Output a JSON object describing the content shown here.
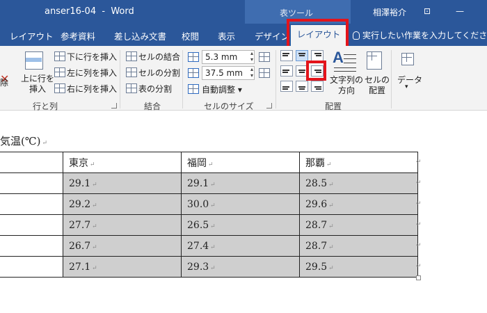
{
  "titlebar": {
    "title": "anser16-04  -  Word",
    "context_tools": "表ツール",
    "user": "相澤裕介",
    "restore_icon": "ribbon-display-icon",
    "minimize_icon": "minimize-icon"
  },
  "tabs": [
    {
      "label": "レイアウト"
    },
    {
      "label": "参考資料"
    },
    {
      "label": "差し込み文書"
    },
    {
      "label": "校閲"
    },
    {
      "label": "表示"
    },
    {
      "label": "デザイン"
    },
    {
      "label": "レイアウト",
      "active": true
    }
  ],
  "tellme": "実行したい作業を入力してください",
  "ribbon": {
    "delete_partial": "除",
    "rows_cols": {
      "insert_above": "上に行を\n挿入",
      "insert_below": "下に行を挿入",
      "insert_left": "左に列を挿入",
      "insert_right": "右に列を挿入",
      "group_label": "行と列"
    },
    "merge": {
      "merge_cells": "セルの結合",
      "split_cells": "セルの分割",
      "split_table": "表の分割",
      "group_label": "結合"
    },
    "cell_size": {
      "height": "5.3 mm",
      "width": "37.5 mm",
      "autofit": "自動調整",
      "group_label": "セルのサイズ"
    },
    "alignment": {
      "text_direction": "文字列の\n方向",
      "cell_margins": "セルの\n配置",
      "group_label": "配置"
    },
    "data": {
      "label": "データ"
    }
  },
  "document": {
    "heading": "気温(℃)",
    "table": {
      "header": [
        "",
        "東京",
        "福岡",
        "那覇"
      ],
      "rows": [
        [
          "",
          "29.1",
          "29.1",
          "28.5"
        ],
        [
          "",
          "29.2",
          "30.0",
          "29.6"
        ],
        [
          "",
          "27.7",
          "26.5",
          "28.7"
        ],
        [
          "",
          "26.7",
          "27.4",
          "28.7"
        ],
        [
          "",
          "27.1",
          "29.3",
          "29.5"
        ]
      ]
    }
  },
  "colors": {
    "word_blue": "#2b579a",
    "highlight_red": "#e3141b",
    "cell_shade": "#cfcfcf"
  }
}
